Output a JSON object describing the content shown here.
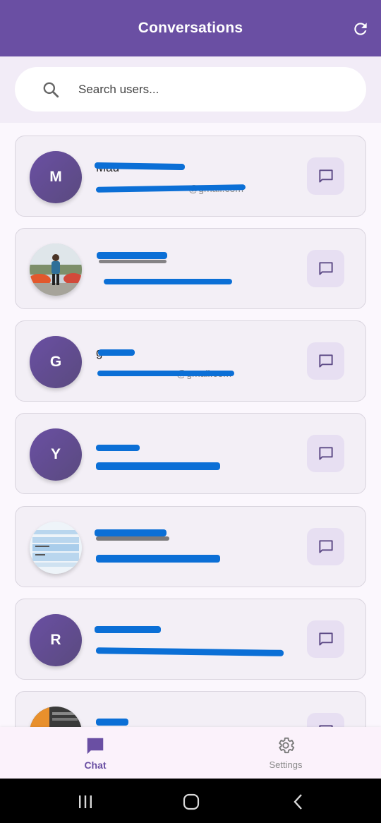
{
  "app_bar": {
    "title": "Conversations",
    "refresh_icon": "refresh-icon"
  },
  "search": {
    "placeholder": "Search users...",
    "value": "",
    "icon": "search-icon"
  },
  "users": [
    {
      "initial": "M",
      "avatar_type": "initial",
      "name": "Mau",
      "email": "@gmail.com"
    },
    {
      "initial": "",
      "avatar_type": "photo",
      "name": "",
      "email": ""
    },
    {
      "initial": "G",
      "avatar_type": "initial",
      "name": "g",
      "email": "@gmail.com"
    },
    {
      "initial": "Y",
      "avatar_type": "initial",
      "name": "",
      "email": ""
    },
    {
      "initial": "",
      "avatar_type": "screenshot",
      "name": "",
      "email": ""
    },
    {
      "initial": "R",
      "avatar_type": "initial",
      "name": "",
      "email": ""
    },
    {
      "initial": "",
      "avatar_type": "photo",
      "name": "",
      "email": ""
    }
  ],
  "bottom_nav": {
    "items": [
      {
        "label": "Chat",
        "icon": "chat-icon",
        "active": true
      },
      {
        "label": "Settings",
        "icon": "settings-icon",
        "active": false
      }
    ]
  },
  "colors": {
    "primary": "#6a4fa3",
    "scribble": "#0b6fd6",
    "card": "#f3eff6"
  }
}
